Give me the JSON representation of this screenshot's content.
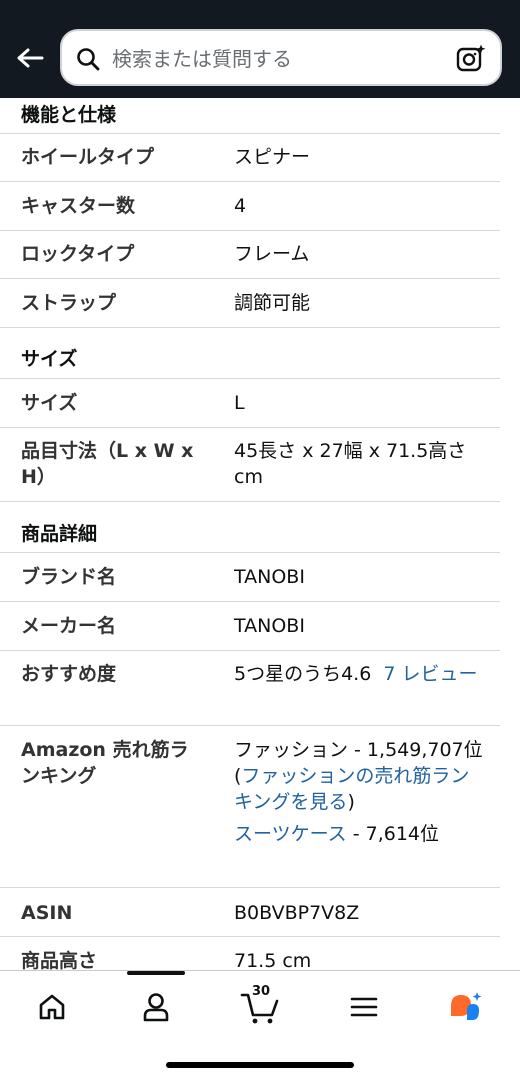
{
  "search": {
    "placeholder": "検索または質問する"
  },
  "sections": {
    "features": {
      "title": "機能と仕様"
    },
    "size": {
      "title": "サイズ"
    },
    "details": {
      "title": "商品詳細"
    }
  },
  "features_rows": [
    {
      "label": "ホイールタイプ",
      "value": "スピナー"
    },
    {
      "label": "キャスター数",
      "value": "4"
    },
    {
      "label": "ロックタイプ",
      "value": "フレーム"
    },
    {
      "label": "ストラップ",
      "value": "調節可能"
    }
  ],
  "size_rows": [
    {
      "label": "サイズ",
      "value": "L"
    },
    {
      "label": "品目寸法（L x W x H）",
      "value": "45長さ x 27幅 x 71.5高さ cm"
    }
  ],
  "details_rows": {
    "brand": {
      "label": "ブランド名",
      "value": "TANOBI"
    },
    "maker": {
      "label": "メーカー名",
      "value": "TANOBI"
    },
    "rating": {
      "label": "おすすめ度",
      "value": "5つ星のうち4.6",
      "reviews_link": "7 レビュー"
    },
    "ranking": {
      "label": "Amazon 売れ筋ランキング",
      "main_prefix": "ファッション - 1,549,707位 (",
      "main_link": "ファッションの売れ筋ランキングを見る",
      "main_suffix": ")",
      "sub_link": "スーツケース",
      "sub_rank": " - 7,614位"
    },
    "asin": {
      "label": "ASIN",
      "value": "B0BVBP7V8Z"
    },
    "height": {
      "label": "商品高さ",
      "value": "71.5 cm"
    }
  },
  "bottom_nav": {
    "cart_count": "30",
    "items": [
      "home-icon",
      "account-icon",
      "cart-icon",
      "menu-icon",
      "rufus-icon"
    ]
  },
  "colors": {
    "topbar": "#131921",
    "link": "#2162a1"
  }
}
